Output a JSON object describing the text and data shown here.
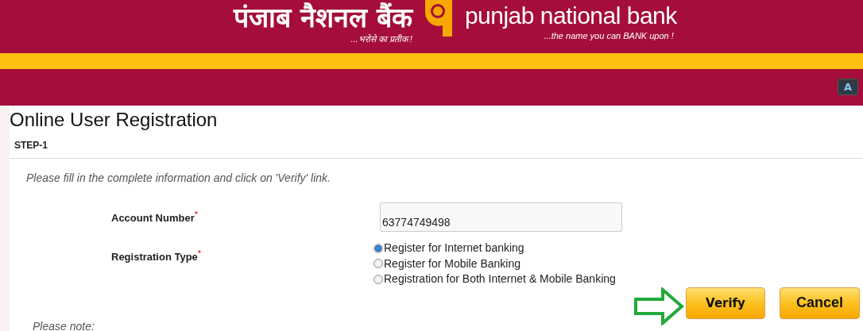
{
  "header": {
    "hindi_name": "पंजाब नैशनल बैंक",
    "hindi_tagline": "...भरोसे का प्रतीक !",
    "english_name": "punjab national bank",
    "english_tagline": "...the name you can BANK upon !",
    "font_button": "A"
  },
  "page": {
    "title": "Online User Registration",
    "step": "STEP-1",
    "instruction": "Please fill in the complete information and click on 'Verify' link."
  },
  "account": {
    "label": "Account Number",
    "required_mark": "*",
    "value": "63774749498"
  },
  "registration": {
    "label": "Registration Type",
    "required_mark": "*",
    "options": [
      {
        "label": "Register for Internet banking",
        "selected": true
      },
      {
        "label": "Register for Mobile Banking",
        "selected": false
      },
      {
        "label": "Registration for Both Internet & Mobile Banking",
        "selected": false
      }
    ]
  },
  "buttons": [
    {
      "label": "Verify"
    },
    {
      "label": "Cancel"
    }
  ],
  "note": "Please note:"
}
